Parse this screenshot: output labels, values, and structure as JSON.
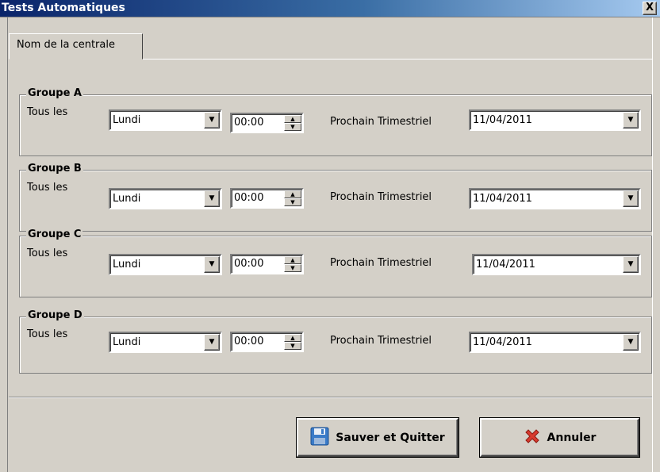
{
  "window": {
    "title": "Tests Automatiques",
    "close_label": "X"
  },
  "tab": {
    "label": "Nom de la centrale"
  },
  "groups": [
    {
      "name": "Groupe A",
      "tous_label": "Tous les",
      "day": "Lundi",
      "time": "00:00",
      "prochain_label": "Prochain Trimestriel",
      "date": "11/04/2011"
    },
    {
      "name": "Groupe B",
      "tous_label": "Tous les",
      "day": "Lundi",
      "time": "00:00",
      "prochain_label": "Prochain Trimestriel",
      "date": "11/04/2011"
    },
    {
      "name": "Groupe C",
      "tous_label": "Tous les",
      "day": "Lundi",
      "time": "00:00",
      "prochain_label": "Prochain Trimestriel",
      "date": "11/04/2011"
    },
    {
      "name": "Groupe D",
      "tous_label": "Tous les",
      "day": "Lundi",
      "time": "00:00",
      "prochain_label": "Prochain Trimestriel",
      "date": "11/04/2011"
    }
  ],
  "buttons": {
    "save_label": "Sauver et Quitter",
    "save_icon": "floppy-disk-icon",
    "cancel_label": "Annuler",
    "cancel_icon": "red-x-icon"
  },
  "colors": {
    "title_gradient_start": "#0a246a",
    "title_gradient_end": "#a6caf0",
    "window_bg": "#d4d0c8"
  }
}
